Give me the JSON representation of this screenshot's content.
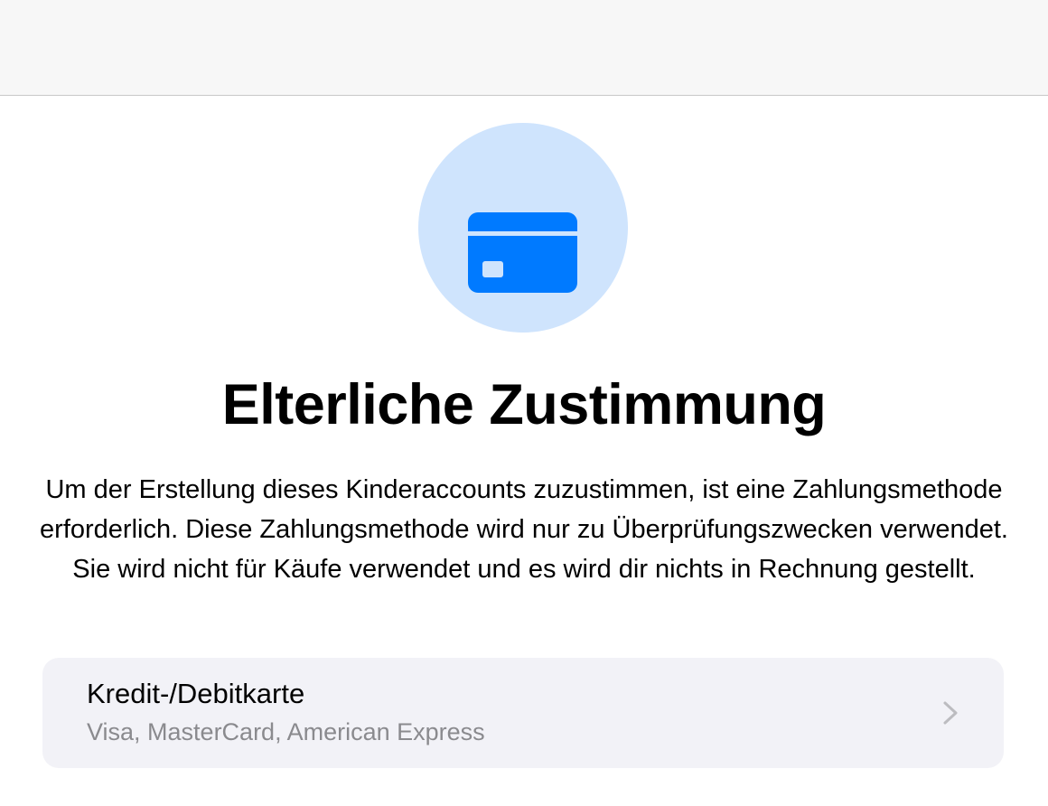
{
  "header": {},
  "hero": {
    "icon": "credit-card-icon",
    "icon_circle_color": "#cfe4fd",
    "icon_color": "#007aff",
    "title": "Elterliche Zustimmung",
    "description": "Um der Erstellung dieses Kinderaccounts zuzustimmen, ist eine Zahlungsmethode erforderlich. Diese Zahlungsmethode wird nur zu Überprüfungszwecken verwendet. Sie wird nicht für Käufe verwendet und es wird dir nichts in Rechnung gestellt."
  },
  "payment_option": {
    "title": "Kredit-/Debitkarte",
    "subtitle": "Visa, MasterCard, American Express",
    "icon": "chevron-right-icon",
    "background_color": "#f2f2f7"
  }
}
